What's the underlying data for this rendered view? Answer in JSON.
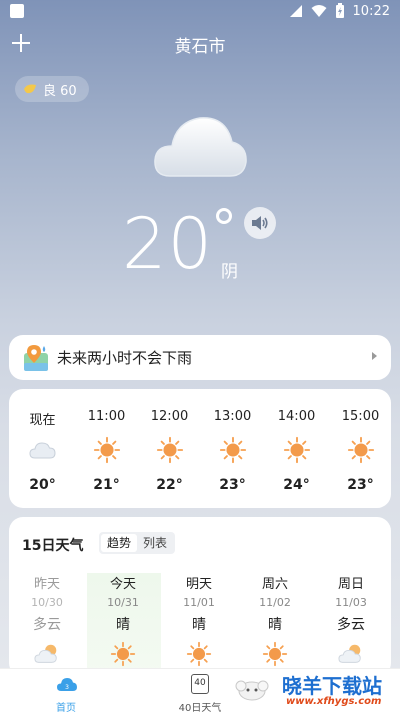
{
  "status_bar": {
    "time": "10:22"
  },
  "header": {
    "city": "黄石市"
  },
  "aqi": {
    "label": "良 60"
  },
  "current": {
    "temp": "20",
    "condition": "阴"
  },
  "rain_banner": {
    "text": "未来两小时不会下雨"
  },
  "hourly": [
    {
      "time": "现在",
      "temp": "20°",
      "icon": "cloud-icon"
    },
    {
      "time": "11:00",
      "temp": "21°",
      "icon": "sun-icon"
    },
    {
      "time": "12:00",
      "temp": "22°",
      "icon": "sun-icon"
    },
    {
      "time": "13:00",
      "temp": "23°",
      "icon": "sun-icon"
    },
    {
      "time": "14:00",
      "temp": "24°",
      "icon": "sun-icon"
    },
    {
      "time": "15:00",
      "temp": "23°",
      "icon": "sun-icon"
    }
  ],
  "daily": {
    "title": "15日天气",
    "toggle": {
      "trend": "趋势",
      "list": "列表"
    },
    "days": [
      {
        "name": "昨天",
        "date": "10/30",
        "cond": "多云",
        "icon": "partly-cloudy-icon"
      },
      {
        "name": "今天",
        "date": "10/31",
        "cond": "晴",
        "icon": "sun-icon"
      },
      {
        "name": "明天",
        "date": "11/01",
        "cond": "晴",
        "icon": "sun-icon"
      },
      {
        "name": "周六",
        "date": "11/02",
        "cond": "晴",
        "icon": "sun-icon"
      },
      {
        "name": "周日",
        "date": "11/03",
        "cond": "多云",
        "icon": "partly-cloudy-icon"
      }
    ]
  },
  "bottom_nav": {
    "home": "首页",
    "forty_day": "40日天气",
    "forty_badge": "40"
  },
  "watermark": {
    "title": "晓羊下载站",
    "url": "www.xfhygs.com"
  },
  "colors": {
    "accent": "#3aa0e8",
    "sun": "#f39a4a",
    "watermark_blue": "#1e6fd0",
    "watermark_red": "#e04a1a"
  }
}
